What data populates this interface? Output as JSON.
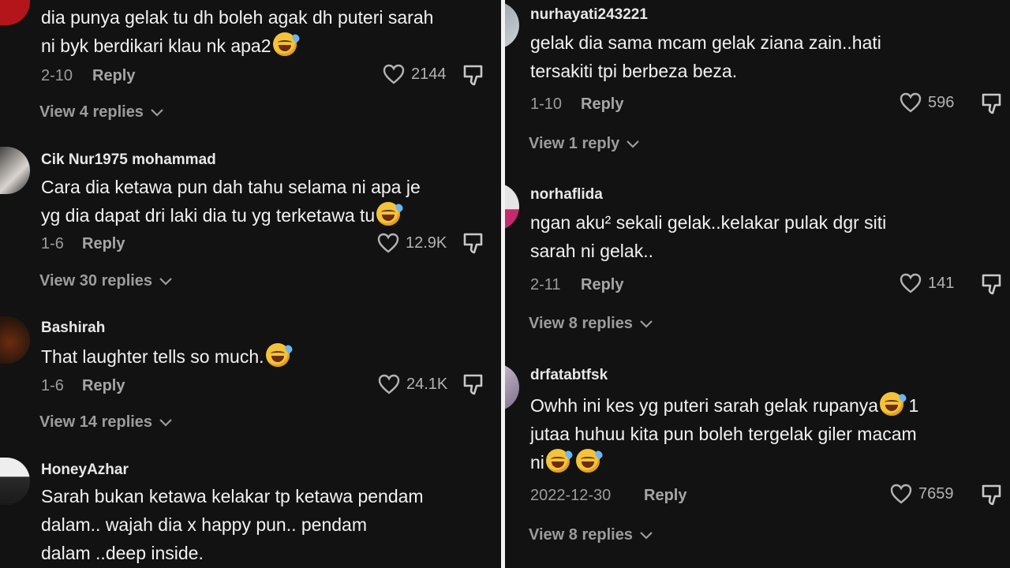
{
  "left_comments": [
    {
      "username": "",
      "lines": [
        "dia punya gelak tu dh boleh agak dh puteri sarah",
        "ni byk berdikari klau nk apa2"
      ],
      "emojis": 1,
      "date": "2-10",
      "reply": "Reply",
      "likes": "2144",
      "view_replies": "View 4 replies"
    },
    {
      "username": "Cik Nur1975 mohammad",
      "lines": [
        "Cara dia ketawa pun dah tahu selama ni apa je",
        "yg dia dapat dri laki dia tu yg terketawa tu"
      ],
      "emojis": 1,
      "date": "1-6",
      "reply": "Reply",
      "likes": "12.9K",
      "view_replies": "View 30 replies"
    },
    {
      "username": "Bashirah",
      "lines": [
        "That laughter tells so much."
      ],
      "emojis": 1,
      "date": "1-6",
      "reply": "Reply",
      "likes": "24.1K",
      "view_replies": "View 14 replies"
    },
    {
      "username": "HoneyAzhar",
      "lines": [
        "Sarah bukan ketawa kelakar tp ketawa pendam",
        "dalam.. wajah dia x happy pun.. pendam",
        "dalam ..deep inside."
      ],
      "emojis": 0
    }
  ],
  "right_comments": [
    {
      "username": "nurhayati243221",
      "lines": [
        "gelak dia sama mcam gelak ziana zain..hati",
        "tersakiti tpi berbeza beza."
      ],
      "date": "1-10",
      "reply": "Reply",
      "likes": "596",
      "view_replies": "View 1 reply"
    },
    {
      "username": "norhaflida",
      "lines": [
        "ngan aku² sekali gelak..kelakar pulak dgr siti",
        "sarah ni gelak.."
      ],
      "date": "2-11",
      "reply": "Reply",
      "likes": "141",
      "view_replies": "View 8 replies"
    },
    {
      "username": "drfatabtfsk",
      "lines": [
        "Owhh ini kes yg puteri sarah gelak rupanya",
        "jutaa huhuu kita pun boleh tergelak giler macam",
        "ni"
      ],
      "line_suffix": [
        "1",
        "",
        ""
      ],
      "date": "2022-12-30",
      "reply": "Reply",
      "likes": "7659",
      "view_replies": "View 8 replies"
    }
  ],
  "colors": {
    "background": "#121212",
    "text": "#f2f2f2",
    "muted": "#9c9c9c",
    "divider": "#f3f3f3"
  },
  "icons": [
    "heart-icon",
    "dislike-icon",
    "chevron-down-icon"
  ]
}
